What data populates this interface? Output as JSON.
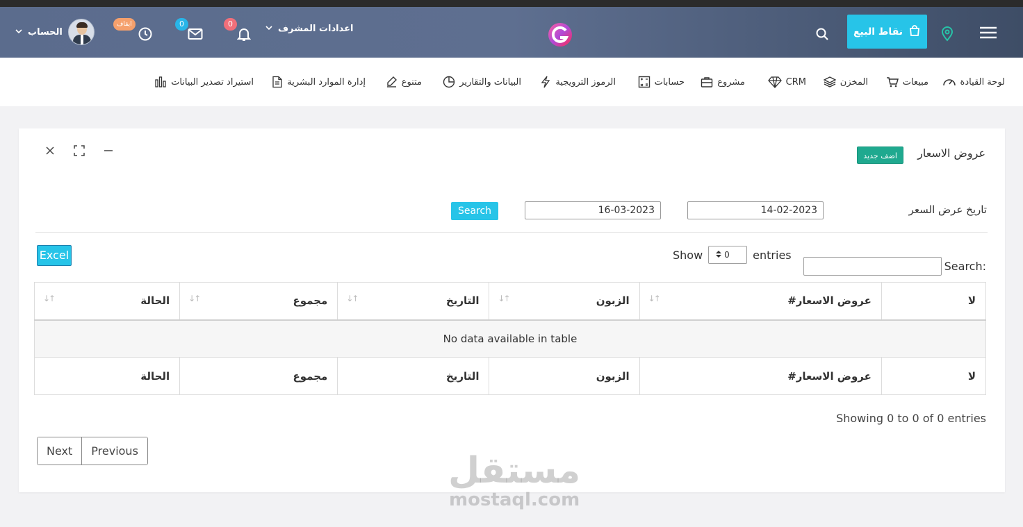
{
  "topbar": {
    "account_label": "الحساب",
    "pause_badge": "ايقاف",
    "mail_count": "0",
    "notif_count": "0",
    "admin_settings": "اعدادات المشرف",
    "pos_label": "نقاط البيع",
    "brand_color": "#27c4e8"
  },
  "menu": {
    "items": [
      {
        "label": "لوحة القيادة",
        "icon": "gauge-icon"
      },
      {
        "label": "مبيعات",
        "icon": "cart-icon"
      },
      {
        "label": "المخزن",
        "icon": "layers-icon"
      },
      {
        "label": "CRM",
        "icon": "diamond-icon"
      },
      {
        "label": "مشروع",
        "icon": "briefcase-icon"
      },
      {
        "label": "حسابات",
        "icon": "calculator-icon"
      },
      {
        "label": "الرموز الترويجية",
        "icon": "bolt-icon"
      },
      {
        "label": "البيانات والتقارير",
        "icon": "pie-chart-icon"
      },
      {
        "label": "متنوع",
        "icon": "edit-icon"
      },
      {
        "label": "إدارة الموارد البشرية",
        "icon": "document-icon"
      },
      {
        "label": "استيراد تصدير البيانات",
        "icon": "bar-chart-icon"
      }
    ]
  },
  "card": {
    "title": "عروض الاسعار",
    "add_new": "اضف جديد"
  },
  "filter": {
    "label": "تاريخ عرض السعر",
    "date_from": "14-02-2023",
    "date_to": "16-03-2023",
    "search_button": "Search"
  },
  "table_controls": {
    "excel": "Excel",
    "show": "Show",
    "page_size": "0",
    "entries": "entries",
    "search_label": "Search:"
  },
  "table": {
    "headers": [
      "لا",
      "عروض الاسعار#",
      "الزبون",
      "التاريخ",
      "مجموع",
      "الحالة"
    ],
    "empty_message": "No data available in table",
    "footers": [
      "لا",
      "عروض الاسعار#",
      "الزبون",
      "التاريخ",
      "مجموع",
      "الحالة"
    ]
  },
  "pagination": {
    "info": "Showing 0 to 0 of 0 entries",
    "previous": "Previous",
    "next": "Next"
  },
  "watermark": {
    "arabic": "مستقل",
    "latin": "mostaql.com"
  }
}
